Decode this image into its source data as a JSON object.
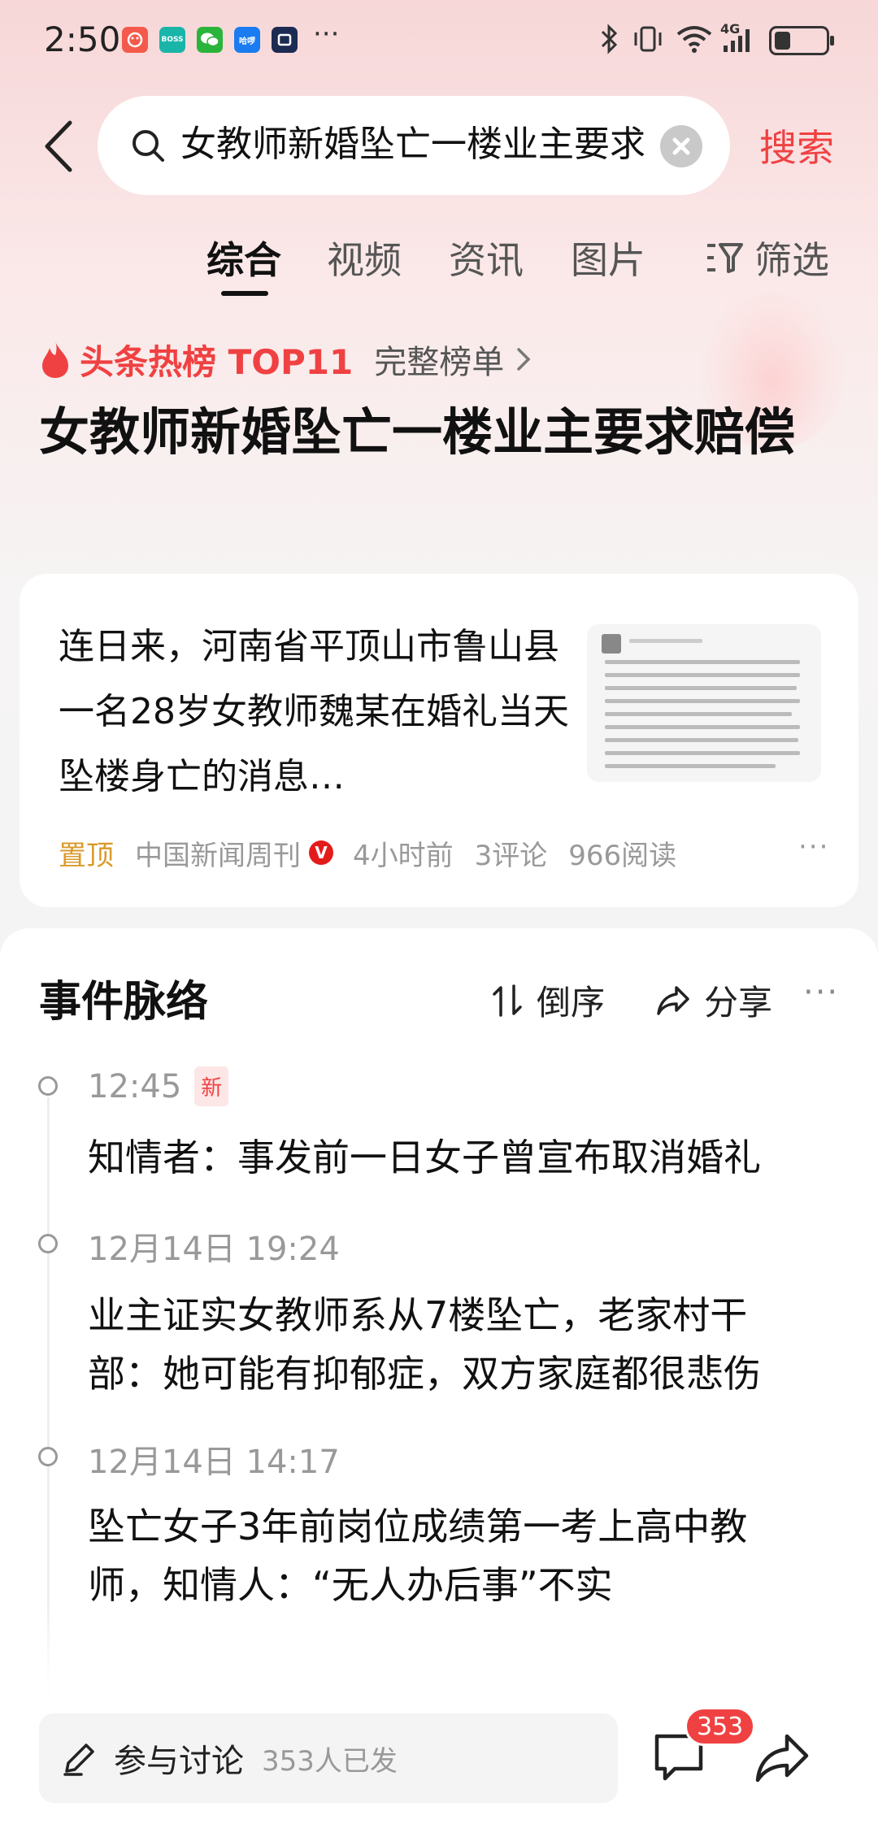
{
  "status_bar": {
    "time": "2:50",
    "app_icons": [
      {
        "name": "app-icon-red",
        "label": "",
        "color": "#f35a4b"
      },
      {
        "name": "boss-zhipin-icon",
        "label": "BOSS",
        "color": "#19b5a9"
      },
      {
        "name": "wechat-icon",
        "label": "",
        "color": "#2bb43b"
      },
      {
        "name": "hello-icon",
        "label": "哈啰",
        "color": "#1a7cf0"
      },
      {
        "name": "app-icon-dark",
        "label": "",
        "color": "#1c2b52"
      }
    ],
    "more": "···",
    "network": "4G",
    "battery_level": 0.3
  },
  "search": {
    "query": "女教师新婚坠亡一楼业主要求赔偿",
    "submit_label": "搜索"
  },
  "tabs": [
    {
      "label": "综合",
      "active": true
    },
    {
      "label": "视频",
      "active": false
    },
    {
      "label": "资讯",
      "active": false
    },
    {
      "label": "图片",
      "active": false
    }
  ],
  "filter_label": "筛选",
  "hot_rank": {
    "label": "头条热榜 TOP11",
    "full_list": "完整榜单",
    "headline": "女教师新婚坠亡一楼业主要求赔偿"
  },
  "article": {
    "summary": "连日来，河南省平顶山市鲁山县一名28岁女教师魏某在婚礼当天坠楼身亡的消息…",
    "pinned": "置顶",
    "source": "中国新闻周刊",
    "verified": "V",
    "time": "4小时前",
    "comments": "3评论",
    "reads": "966阅读",
    "more": "···"
  },
  "timeline": {
    "title": "事件脉络",
    "sort_label": "倒序",
    "share_label": "分享",
    "more": "···",
    "events": [
      {
        "time": "12:45",
        "badge": "新",
        "text": "知情者：事发前一日女子曾宣布取消婚礼"
      },
      {
        "time": "12月14日 19:24",
        "badge": "",
        "text": "业主证实女教师系从7楼坠亡，老家村干部：她可能有抑郁症，双方家庭都很悲伤"
      },
      {
        "time": "12月14日 14:17",
        "badge": "",
        "text": "坠亡女子3年前岗位成绩第一考上高中教师，知情人：“无人办后事”不实"
      }
    ]
  },
  "bottom": {
    "discuss_label": "参与讨论",
    "discuss_count": "353人已发",
    "comment_badge": "353"
  },
  "colors": {
    "accent": "#f04142",
    "pin": "#d99a2b",
    "muted": "#999999"
  }
}
